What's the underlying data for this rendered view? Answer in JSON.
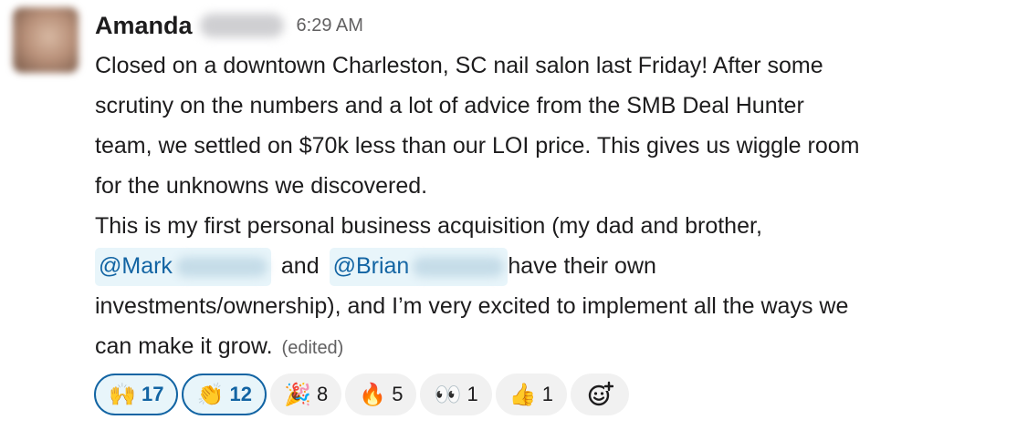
{
  "message": {
    "author": "Amanda",
    "timestamp": "6:29 AM",
    "lines": [
      "Closed on a downtown Charleston, SC nail salon last Friday! After some",
      "scrutiny on the numbers and a lot of advice from the SMB Deal Hunter",
      "team, we settled on $70k less than our LOI price. This gives us wiggle room",
      "for the unknowns we discovered.",
      "This is my first personal business acquisition (my dad and brother,"
    ],
    "mention_1": "@Mark",
    "and_text": "and",
    "mention_2": "@Brian",
    "after_mentions": "have their own",
    "line_8": "investments/ownership), and I’m very excited to implement all the ways we",
    "line_9": "can make it grow.",
    "edited_label": "(edited)"
  },
  "reactions": [
    {
      "icon": "raised-hands-icon",
      "glyph": "🙌",
      "count": "17",
      "active": true
    },
    {
      "icon": "clapping-hands-icon",
      "glyph": "👏",
      "count": "12",
      "active": true
    },
    {
      "icon": "party-popper-icon",
      "glyph": "🎉",
      "count": "8",
      "active": false
    },
    {
      "icon": "fire-icon",
      "glyph": "🔥",
      "count": "5",
      "active": false
    },
    {
      "icon": "eyes-icon",
      "glyph": "👀",
      "count": "1",
      "active": false
    },
    {
      "icon": "thumbs-up-icon",
      "glyph": "👍",
      "count": "1",
      "active": false
    }
  ],
  "add_reaction_icon": "add-reaction-icon",
  "colors": {
    "mention_text": "#1264a3",
    "mention_bg": "#e8f5fa",
    "active_reaction_border": "#1264a3",
    "reaction_bg": "#f1f1f1"
  }
}
